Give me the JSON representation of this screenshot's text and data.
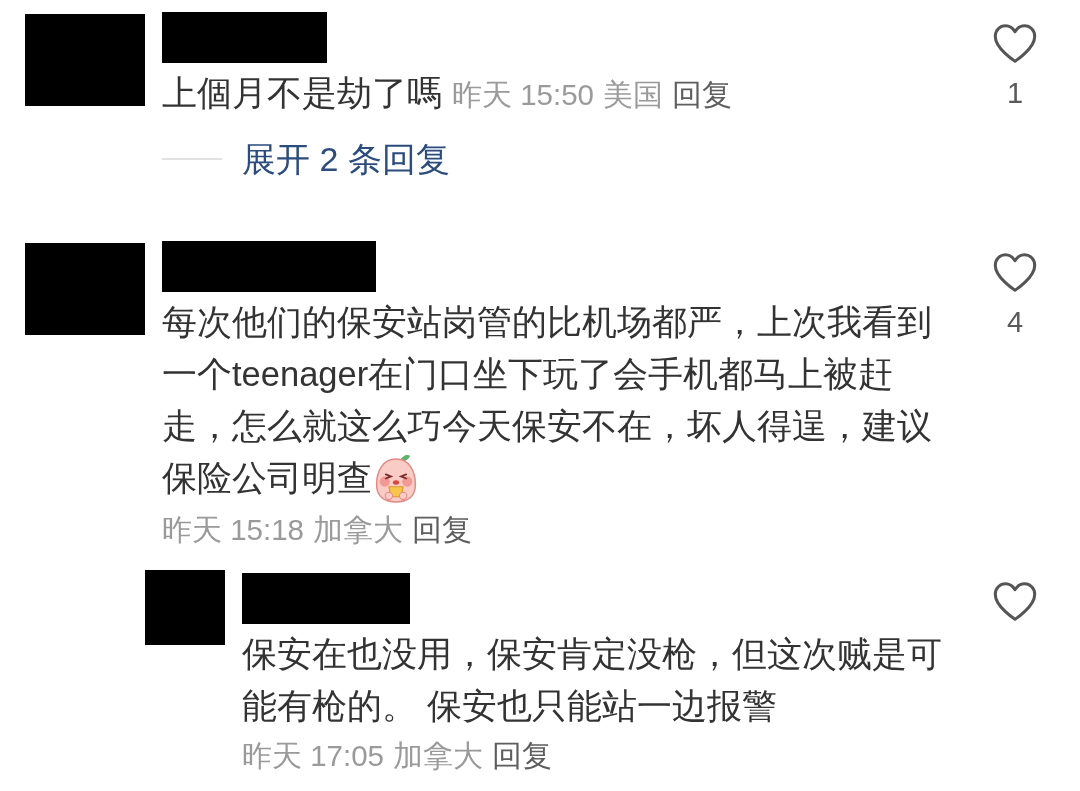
{
  "comments": [
    {
      "text": "上個月不是劫了嗎",
      "date": "昨天 15:50",
      "location": "美国",
      "reply_action": "回复",
      "liked": false,
      "like_count": "1",
      "replies_toggle": "展开 2 条回复"
    },
    {
      "text": "每次他们的保安站岗管的比机场都严，上次我看到一个teenager在门口坐下玩了会手机都马上被赶走，怎么就这么巧今天保安不在，坏人得逞，建议保险公司明查",
      "sticker": true,
      "date": "昨天 15:18",
      "location": "加拿大",
      "reply_action": "回复",
      "liked": false,
      "like_count": "4",
      "replies": [
        {
          "text": "保安在也没用，保安肯定没枪，但这次贼是可能有枪的。 保安也只能站一边报警",
          "date": "昨天 17:05",
          "location": "加拿大",
          "reply_action": "回复",
          "liked": false
        }
      ]
    }
  ]
}
